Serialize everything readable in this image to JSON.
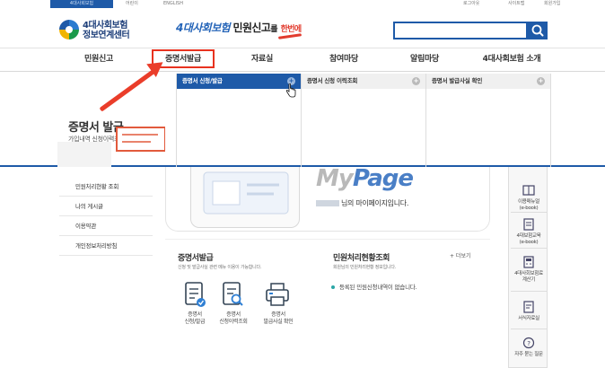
{
  "topbar": {
    "active_tab": "4대사회보험",
    "link_1": "어린이",
    "link_2": "ENGLISH",
    "logout": "로그아웃",
    "sitemap": "사이트맵",
    "register": "회원가입"
  },
  "header": {
    "logo_line1": "4대사회보험",
    "logo_line2": "정보연계센터",
    "banner_part1": "4대사회보험",
    "banner_part2": "민원신고",
    "banner_part3": "를",
    "banner_part4": "한번에"
  },
  "search": {
    "placeholder": ""
  },
  "gnb": {
    "items": [
      {
        "label": "민원신고"
      },
      {
        "label": "증명서발급"
      },
      {
        "label": "자료실"
      },
      {
        "label": "참여마당"
      },
      {
        "label": "알림마당"
      },
      {
        "label": "4대사회보험 소개"
      }
    ]
  },
  "dropdown": {
    "title": "증명서 발급",
    "subtitle": "가입내역 신청이력조회합니다.",
    "columns": [
      {
        "label": "증명서 신청/발급"
      },
      {
        "label": "증명서 신청 이력조회"
      },
      {
        "label": "증명서 발급사실 확인"
      }
    ]
  },
  "lnb": {
    "items": [
      {
        "label": "민원처리현황 조회"
      },
      {
        "label": "나의 게시글"
      },
      {
        "label": "이용약관"
      },
      {
        "label": "개인정보처리방침"
      }
    ]
  },
  "mypage": {
    "title_part1": "My",
    "title_part2": "Page",
    "greeting": "님의 마이페이지입니다."
  },
  "cert_section": {
    "title": "증명서발급",
    "desc": "신청 및 발급사실 관련 메뉴 이용이 가능합니다.",
    "items": [
      {
        "line1": "증명서",
        "line2": "신청/발급"
      },
      {
        "line1": "증명서",
        "line2": "신청이력조회"
      },
      {
        "line1": "증명서",
        "line2": "발급사실 확인"
      }
    ]
  },
  "status_section": {
    "title": "민원처리현황조회",
    "desc": "회원님의 민원처리현황 정보입니다.",
    "more": "+ 더보기",
    "notice": "등록된 민원신청내역이 없습니다."
  },
  "quick": {
    "items": [
      {
        "line1": "이용매뉴얼",
        "line2": "(e-book)"
      },
      {
        "line1": "4대보험교육",
        "line2": "(e-book)"
      },
      {
        "line1": "4대사회보험료",
        "line2": "계산기"
      },
      {
        "line1": "서식자료실",
        "line2": ""
      },
      {
        "line1": "자주 묻는 질문",
        "line2": ""
      }
    ]
  },
  "colors": {
    "brand_blue": "#1e5aa8",
    "highlight_red": "#e8321f"
  }
}
